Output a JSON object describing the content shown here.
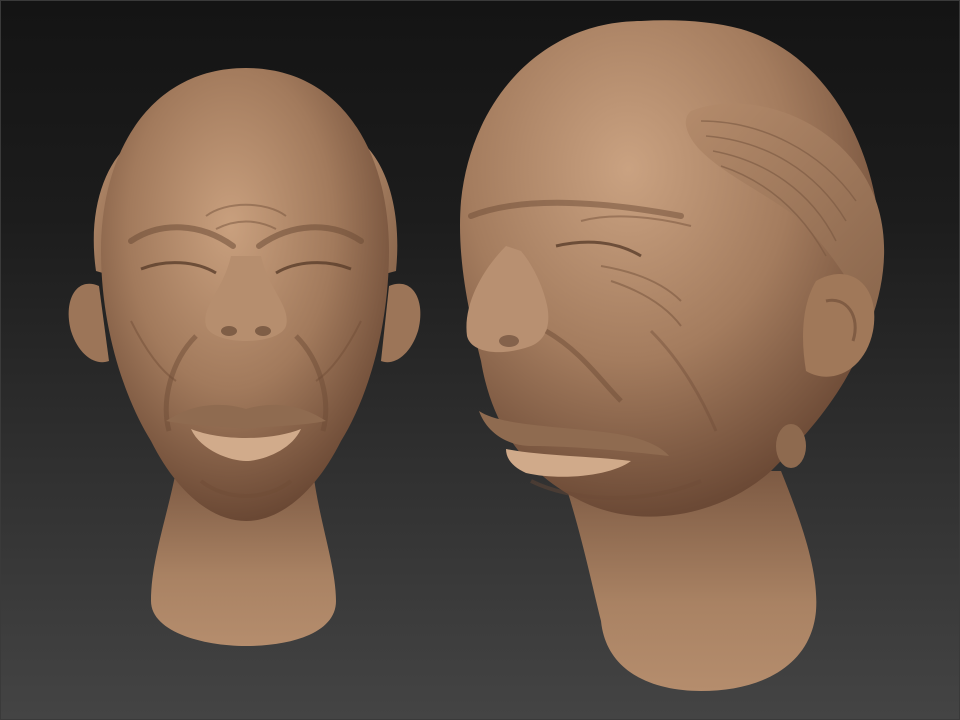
{
  "scene": {
    "subject": "clay-sculpt-heads",
    "colors": {
      "clay": "#a27a5c",
      "clay_light": "#c49b7a",
      "clay_dark": "#6e4c36",
      "background_top": "#141414",
      "background_bottom": "#444444"
    }
  }
}
